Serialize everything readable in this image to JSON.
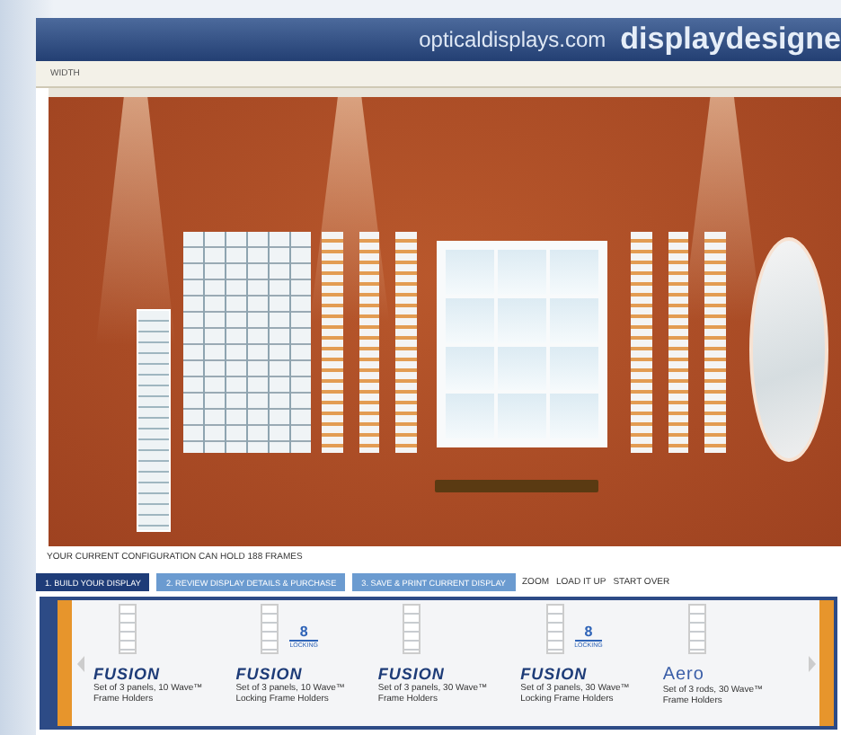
{
  "header": {
    "site": "opticaldisplays.com",
    "product": "displaydesigne"
  },
  "ruler": {
    "label": "WIDTH"
  },
  "wall": {
    "items": [
      {
        "kind": "spotlight"
      },
      {
        "kind": "spotlight"
      },
      {
        "kind": "spotlight"
      },
      {
        "kind": "panel"
      },
      {
        "kind": "grid"
      },
      {
        "kind": "columns"
      },
      {
        "kind": "window"
      },
      {
        "kind": "columns"
      },
      {
        "kind": "mirror"
      },
      {
        "kind": "shelf"
      }
    ]
  },
  "status": "YOUR CURRENT CONFIGURATION CAN HOLD 188 FRAMES",
  "tabs": [
    {
      "label": "1. BUILD YOUR DISPLAY",
      "selected": true
    },
    {
      "label": "2. REVIEW DISPLAY DETAILS & PURCHASE",
      "selected": false
    },
    {
      "label": "3. SAVE & PRINT CURRENT DISPLAY",
      "selected": false
    }
  ],
  "tools": [
    "ZOOM",
    "LOAD IT UP",
    "START OVER"
  ],
  "products": [
    {
      "brand": "FUSION",
      "description": "Set of 3 panels, 10 Wave™ Frame Holders"
    },
    {
      "brand": "FUSION",
      "description": "Set of 3 panels, 10 Wave™ Locking Frame Holders",
      "badge": "8",
      "badge_label": "LOCKING"
    },
    {
      "brand": "FUSION",
      "description": "Set of 3 panels, 30 Wave™ Frame Holders"
    },
    {
      "brand": "FUSION",
      "description": "Set of 3 panels, 30 Wave™ Locking Frame Holders",
      "badge": "8",
      "badge_label": "LOCKING"
    },
    {
      "brand": "Aero",
      "description": "Set of 3 rods, 30 Wave™ Frame Holders"
    }
  ]
}
